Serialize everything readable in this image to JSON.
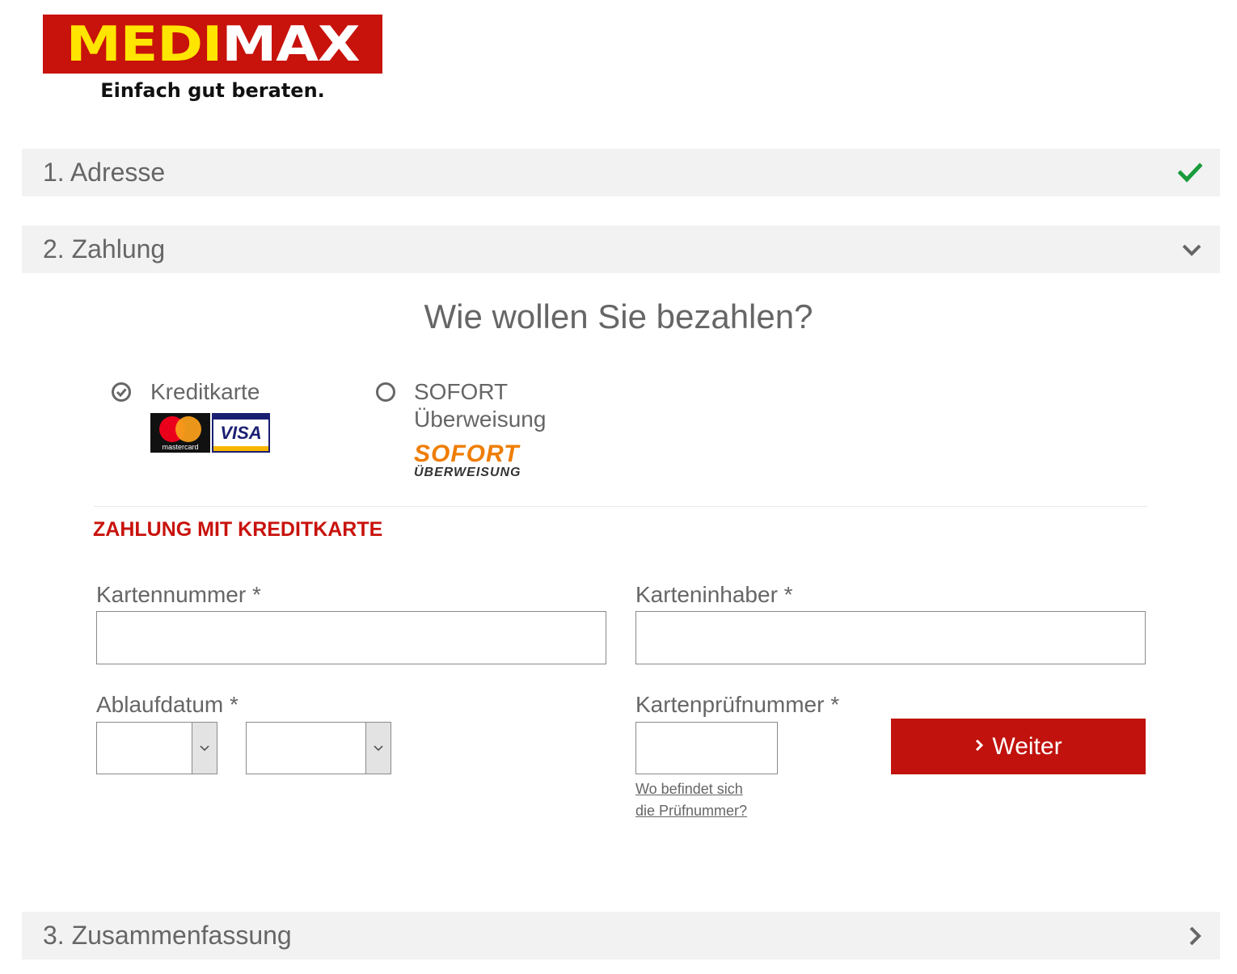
{
  "brand": {
    "logo_part1": "MEDI",
    "logo_part2": "MAX",
    "tagline": "Einfach gut beraten.",
    "colors": {
      "brand_red": "#c8120c",
      "logo_yellow": "#ffe500"
    }
  },
  "steps": [
    {
      "label": "1. Adresse",
      "icon": "check-icon",
      "icon_color": "#1a9b3c"
    },
    {
      "label": "2. Zahlung",
      "icon": "chevron-down-icon"
    },
    {
      "label": "3. Zusammenfassung",
      "icon": "chevron-right-icon"
    }
  ],
  "payment": {
    "heading": "Wie wollen Sie bezahlen?",
    "options": [
      {
        "label": "Kreditkarte",
        "selected": true,
        "logos": [
          "mastercard",
          "VISA"
        ]
      },
      {
        "label_line1": "SOFORT",
        "label_line2": "Überweisung",
        "selected": false,
        "logo_line1": "SOFORT",
        "logo_line2": "ÜBERWEISUNG"
      }
    ]
  },
  "card_form": {
    "title": "ZAHLUNG MIT KREDITKARTE",
    "card_number_label": "Kartennummer *",
    "card_number_value": "",
    "card_holder_label": "Karteninhaber *",
    "card_holder_value": "",
    "expiry_label": "Ablaufdatum *",
    "expiry_month_value": "",
    "expiry_year_value": "",
    "cvc_label": "Kartenprüfnummer *",
    "cvc_value": "",
    "cvc_help_line1": "Wo befindet sich",
    "cvc_help_line2": "die Prüfnummer?",
    "submit_label": "Weiter"
  }
}
